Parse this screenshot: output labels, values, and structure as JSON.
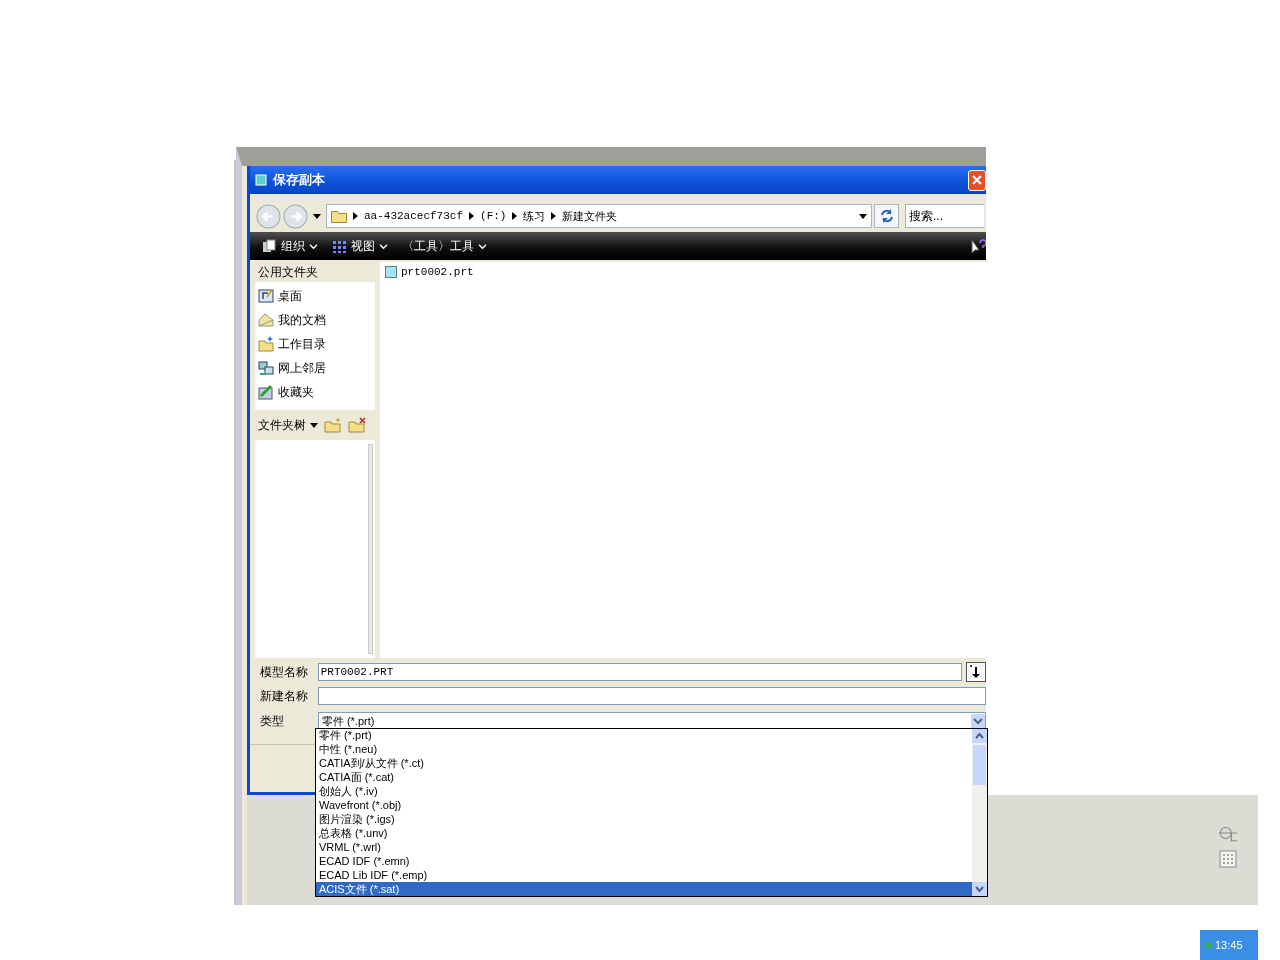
{
  "window": {
    "title": "保存副本"
  },
  "address_bar": {
    "breadcrumbs": [
      "aa-432acecf73cf",
      "(F:)",
      "练习",
      "新建文件夹"
    ]
  },
  "search": {
    "placeholder": "搜索..."
  },
  "toolbar": [
    {
      "label": "组织"
    },
    {
      "label": "视图"
    },
    {
      "label": "〈工具〉工具"
    }
  ],
  "sidebar": {
    "title": "公用文件夹",
    "items": [
      {
        "label": "桌面"
      },
      {
        "label": "我的文档"
      },
      {
        "label": "工作目录"
      },
      {
        "label": "网上邻居"
      },
      {
        "label": "收藏夹"
      }
    ]
  },
  "folder_tree": {
    "title": "文件夹树"
  },
  "files": [
    {
      "name": "prt0002.prt"
    }
  ],
  "form": {
    "model_name": {
      "label": "模型名称",
      "value": "PRT0002.PRT"
    },
    "new_name": {
      "label": "新建名称"
    },
    "type": {
      "label": "类型",
      "value": "零件 (*.prt)"
    }
  },
  "type_dropdown": {
    "options": [
      {
        "label": "零件 (*.prt)",
        "selected": false
      },
      {
        "label": "中性 (*.neu)",
        "selected": false
      },
      {
        "label": "CATIA到/从文件 (*.ct)",
        "selected": false
      },
      {
        "label": "CATIA面 (*.cat)",
        "selected": false
      },
      {
        "label": "创始人 (*.iv)",
        "selected": false
      },
      {
        "label": "Wavefront (*.obj)",
        "selected": false
      },
      {
        "label": "图片渲染 (*.igs)",
        "selected": false
      },
      {
        "label": "总表格 (*.unv)",
        "selected": false
      },
      {
        "label": "VRML (*.wrl)",
        "selected": false
      },
      {
        "label": "ECAD IDF (*.emn)",
        "selected": false
      },
      {
        "label": "ECAD Lib IDF (*.emp)",
        "selected": false
      },
      {
        "label": "ACIS文件 (*.sat)",
        "selected": true
      }
    ]
  },
  "taskbar": {
    "clock": "13:45"
  }
}
